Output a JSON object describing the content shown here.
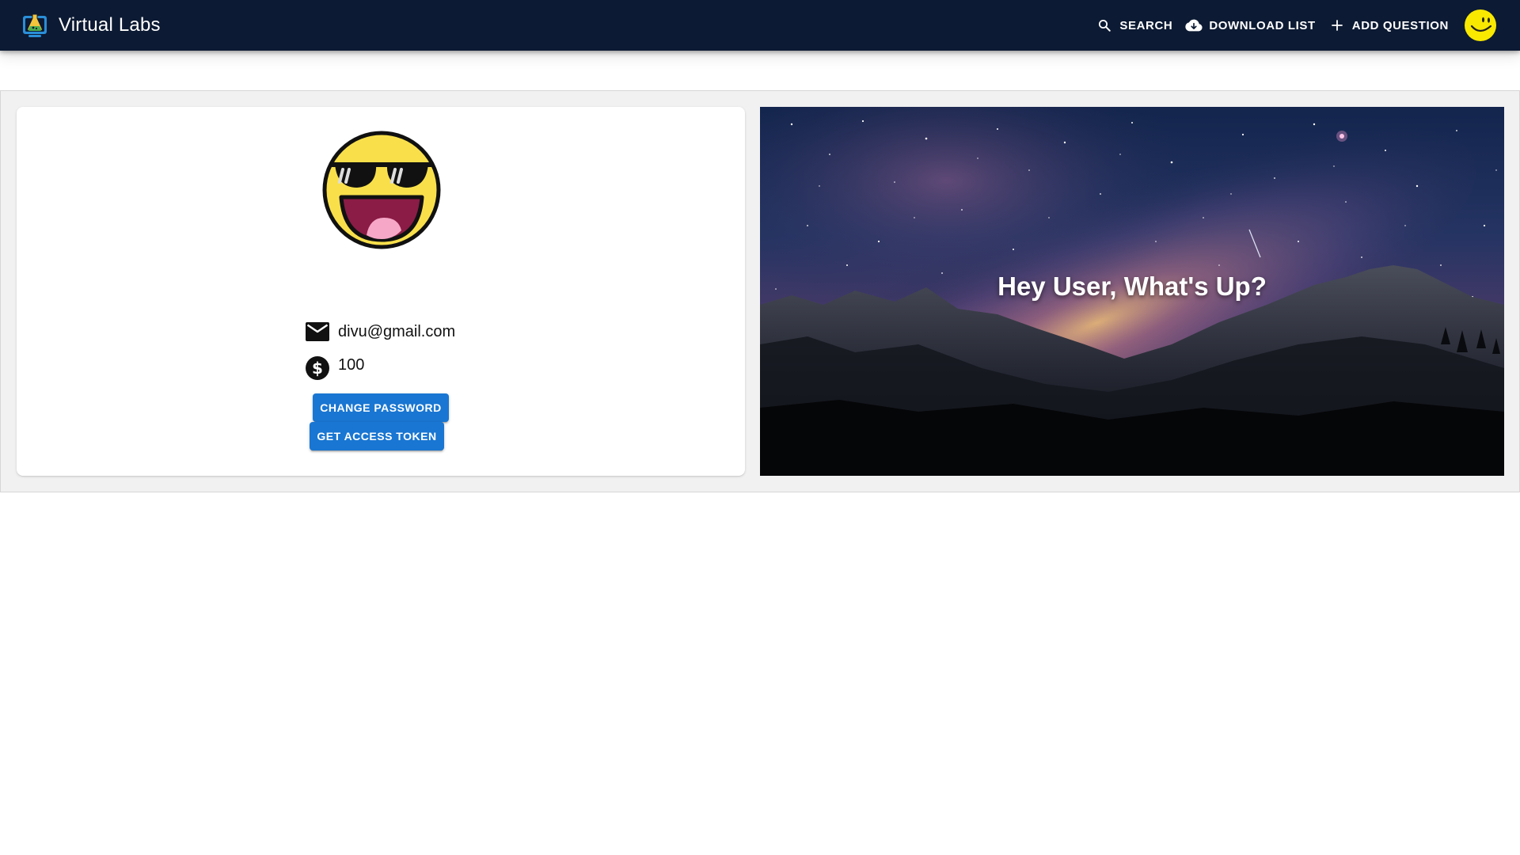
{
  "app": {
    "title": "Virtual Labs",
    "logo_icon": "flask-monitor-icon"
  },
  "nav": {
    "search_label": "SEARCH",
    "search_icon": "search-icon",
    "download_label": "DOWNLOAD LIST",
    "download_icon": "cloud-download-icon",
    "add_question_label": "ADD QUESTION",
    "add_question_icon": "plus-icon",
    "avatar_icon": "smiley-face-icon"
  },
  "profile": {
    "avatar_icon": "sunglasses-smiley-icon",
    "email": "divu@gmail.com",
    "email_icon": "mail-icon",
    "credits": "100",
    "credits_icon": "dollar-circle-icon",
    "change_password_label": "CHANGE PASSWORD",
    "access_token_label": "GET ACCESS TOKEN"
  },
  "banner": {
    "greeting": "Hey User, What's Up?",
    "image": "night-sky-milky-way-mountains"
  },
  "colors": {
    "appbar_bg": "#0c1a33",
    "primary_button": "#1976d2",
    "content_bg": "#f1f1f1",
    "smiley_yellow": "#f9e04b"
  }
}
